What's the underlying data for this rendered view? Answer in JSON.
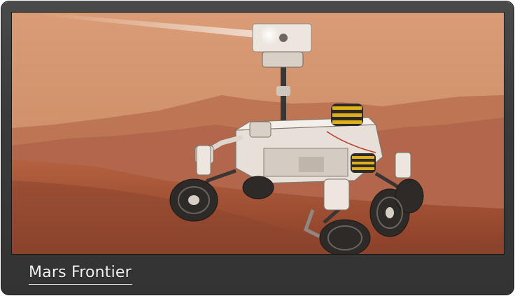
{
  "card": {
    "caption": "Mars Frontier",
    "image": {
      "subject": "mars-rover",
      "colors": {
        "sky_top": "#d59a72",
        "sky_bottom": "#c98a64",
        "ground": "#a9583a",
        "hills": "#b46a48",
        "rover_body": "#e9e3dc",
        "wheel": "#2e2a27",
        "caution_stripe": "#e0b01a"
      }
    }
  }
}
